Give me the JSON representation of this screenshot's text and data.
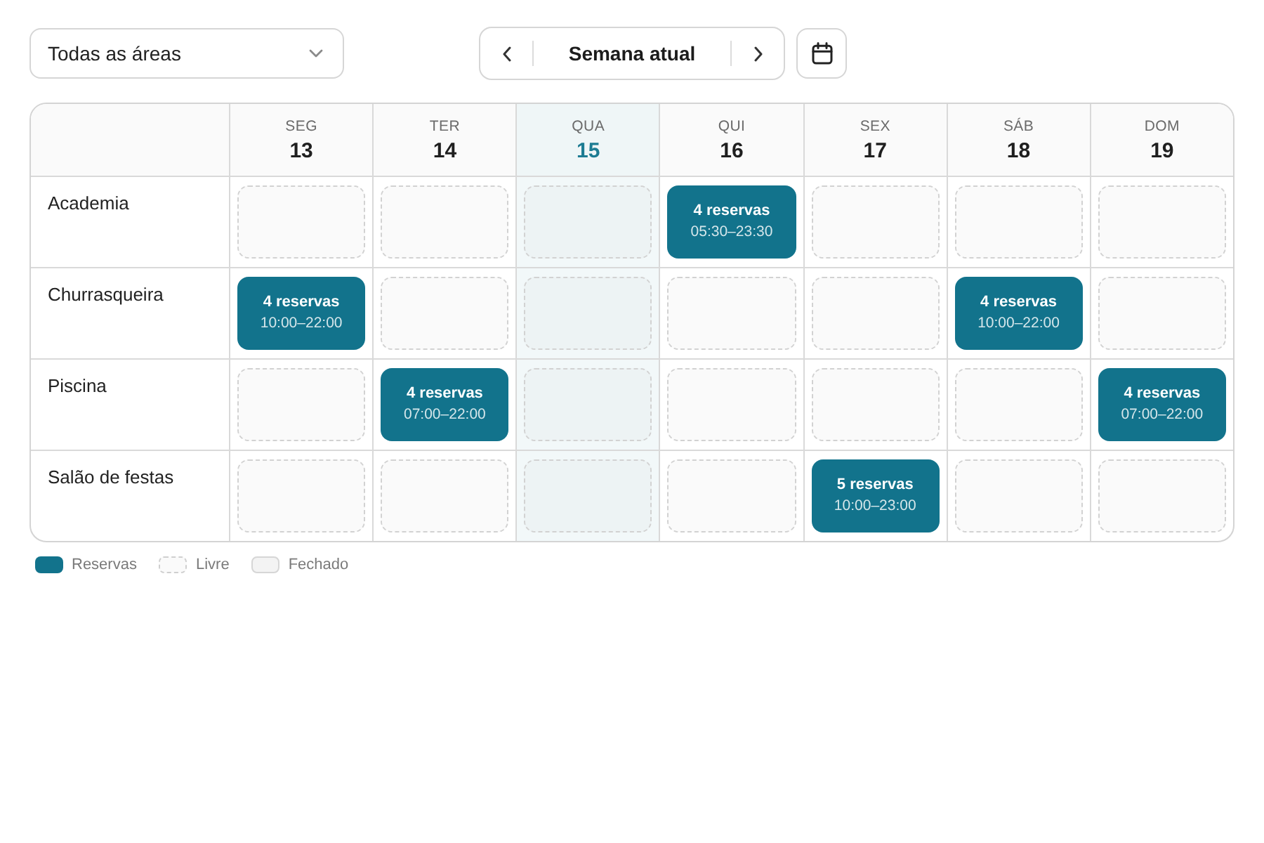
{
  "toolbar": {
    "area_select": {
      "value": "Todas as áreas"
    },
    "week_nav": {
      "label": "Semana atual"
    }
  },
  "calendar": {
    "days": [
      {
        "weekday": "SEG",
        "date": "13",
        "today": false
      },
      {
        "weekday": "TER",
        "date": "14",
        "today": false
      },
      {
        "weekday": "QUA",
        "date": "15",
        "today": true
      },
      {
        "weekday": "QUI",
        "date": "16",
        "today": false
      },
      {
        "weekday": "SEX",
        "date": "17",
        "today": false
      },
      {
        "weekday": "SÁB",
        "date": "18",
        "today": false
      },
      {
        "weekday": "DOM",
        "date": "19",
        "today": false
      }
    ],
    "rows": [
      {
        "area": "Academia",
        "slots": [
          {
            "kind": "free"
          },
          {
            "kind": "free"
          },
          {
            "kind": "free"
          },
          {
            "kind": "booked",
            "count": "4 reservas",
            "hours": "05:30–23:30"
          },
          {
            "kind": "free"
          },
          {
            "kind": "free"
          },
          {
            "kind": "free"
          }
        ]
      },
      {
        "area": "Churrasqueira",
        "slots": [
          {
            "kind": "booked",
            "count": "4 reservas",
            "hours": "10:00–22:00"
          },
          {
            "kind": "free"
          },
          {
            "kind": "free"
          },
          {
            "kind": "free"
          },
          {
            "kind": "free"
          },
          {
            "kind": "booked",
            "count": "4 reservas",
            "hours": "10:00–22:00"
          },
          {
            "kind": "free"
          }
        ]
      },
      {
        "area": "Piscina",
        "slots": [
          {
            "kind": "free"
          },
          {
            "kind": "booked",
            "count": "4 reservas",
            "hours": "07:00–22:00"
          },
          {
            "kind": "free"
          },
          {
            "kind": "free"
          },
          {
            "kind": "free"
          },
          {
            "kind": "free"
          },
          {
            "kind": "booked",
            "count": "4 reservas",
            "hours": "07:00–22:00"
          }
        ]
      },
      {
        "area": "Salão de festas",
        "slots": [
          {
            "kind": "free"
          },
          {
            "kind": "free"
          },
          {
            "kind": "free"
          },
          {
            "kind": "free"
          },
          {
            "kind": "booked",
            "count": "5 reservas",
            "hours": "10:00–23:00"
          },
          {
            "kind": "free"
          },
          {
            "kind": "free"
          }
        ]
      }
    ]
  },
  "legend": [
    {
      "kind": "booked",
      "label": "Reservas"
    },
    {
      "kind": "free",
      "label": "Livre"
    },
    {
      "kind": "closed",
      "label": "Fechado"
    }
  ]
}
